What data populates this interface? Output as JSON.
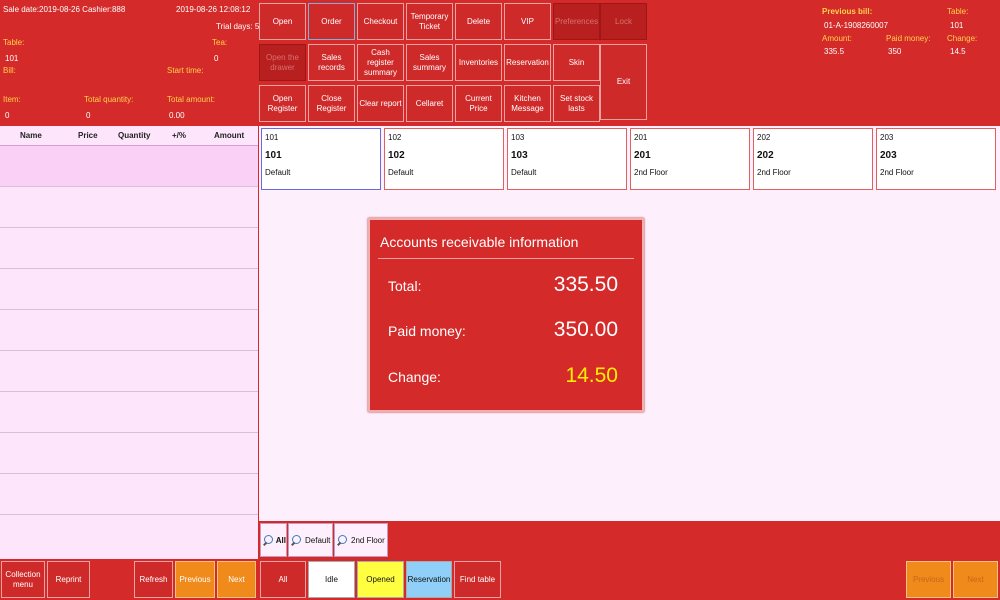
{
  "info": {
    "sale_date": "Sale date:2019-08-26 Cashier:888",
    "datetime": "2019-08-26 12:08:12",
    "trial_days": "Trial days: 5",
    "table_label": "Table:",
    "table_value": "101",
    "tea_label": "Tea:",
    "tea_value": "0",
    "bill_label": "Bill:",
    "start_time_label": "Start time:",
    "item_label": "Item:",
    "item_value": "0",
    "total_qty_label": "Total quantity:",
    "total_qty_value": "0",
    "total_amount_label": "Total amount:",
    "total_amount_value": "0.00"
  },
  "function_buttons": {
    "open": "Open",
    "order": "Order",
    "checkout": "Checkout",
    "temporary_ticket": "Temporary Ticket",
    "delete": "Delete",
    "vip": "VIP",
    "preferences": "Preferences",
    "lock": "Lock",
    "open_drawer": "Open the drawer",
    "sales_records": "Sales records",
    "cash_register_summary": "Cash register summary",
    "sales_summary": "Sales summary",
    "inventories": "Inventories",
    "reservation": "Reservation",
    "skin": "Skin",
    "exit": "Exit",
    "open_register": "Open Register",
    "close_register": "Close Register",
    "clear_report": "Clear report",
    "cellaret": "Cellaret",
    "current_price": "Current Price",
    "kitchen_message": "Kitchen Message",
    "set_stock_lasts": "Set stock lasts"
  },
  "previous_bill": {
    "title": "Previous bill:",
    "bill_no": "01-A-1908260007",
    "table_label": "Table:",
    "table_value": "101",
    "amount_label": "Amount:",
    "amount_value": "335.5",
    "paid_label": "Paid money:",
    "paid_value": "350",
    "change_label": "Change:",
    "change_value": "14.5"
  },
  "order_list": {
    "columns": [
      "Name",
      "Price",
      "Quantity",
      "+/%",
      "Amount"
    ]
  },
  "tables": [
    {
      "code": "101",
      "name": "101",
      "area": "Default"
    },
    {
      "code": "102",
      "name": "102",
      "area": "Default"
    },
    {
      "code": "103",
      "name": "103",
      "area": "Default"
    },
    {
      "code": "201",
      "name": "201",
      "area": "2nd Floor"
    },
    {
      "code": "202",
      "name": "202",
      "area": "2nd Floor"
    },
    {
      "code": "203",
      "name": "203",
      "area": "2nd Floor"
    }
  ],
  "dialog": {
    "title": "Accounts receivable information",
    "total_label": "Total:",
    "total_value": "335.50",
    "paid_label": "Paid money:",
    "paid_value": "350.00",
    "change_label": "Change:",
    "change_value": "14.50",
    "change_color": "#ffee00"
  },
  "areas": [
    "All",
    "Default",
    "2nd Floor"
  ],
  "bottom": {
    "collection_menu": "Collection menu",
    "reprint": "Reprint",
    "refresh": "Refresh",
    "previous": "Previous",
    "next": "Next",
    "all": "All",
    "idle": "Idle",
    "opened": "Opened",
    "reservation": "Reservation",
    "find_table": "Find table",
    "previous2": "Previous",
    "next2": "Next"
  },
  "colors": {
    "background": "#d42a2a",
    "list_bg": "#fde6fb",
    "accent_orange": "#f08a1a",
    "label_yellow": "#ffd24a"
  }
}
